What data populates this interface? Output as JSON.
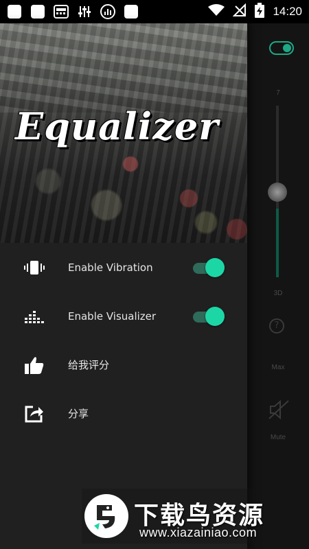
{
  "status_bar": {
    "time": "14:20",
    "icons": [
      "notification-square-icon",
      "notification-square-icon",
      "radio-app-icon",
      "equalizer-sliders-icon",
      "visualizer-dots-icon",
      "notification-square-icon"
    ],
    "right_icons": [
      "wifi-icon",
      "no-signal-icon",
      "battery-charging-icon"
    ]
  },
  "drawer": {
    "header_title": "Equalizer",
    "items": [
      {
        "label": "Enable Vibration",
        "icon": "vibration-icon",
        "toggle_on": true
      },
      {
        "label": "Enable Visualizer",
        "icon": "visualizer-bars-icon",
        "toggle_on": true
      },
      {
        "label": "给我评分",
        "icon": "thumbs-up-icon"
      },
      {
        "label": "分享",
        "icon": "share-icon"
      }
    ]
  },
  "background": {
    "label_top": "7",
    "label_band": "3D",
    "label_max": "Max",
    "label_mute": "Mute"
  },
  "watermark": {
    "title": "下载鸟资源",
    "url": "www.xiazainiao.com"
  },
  "colors": {
    "accent": "#1dd6a6",
    "accent_track": "#2f6b5a",
    "drawer_bg": "#202020",
    "statusbar_bg": "#000000"
  }
}
